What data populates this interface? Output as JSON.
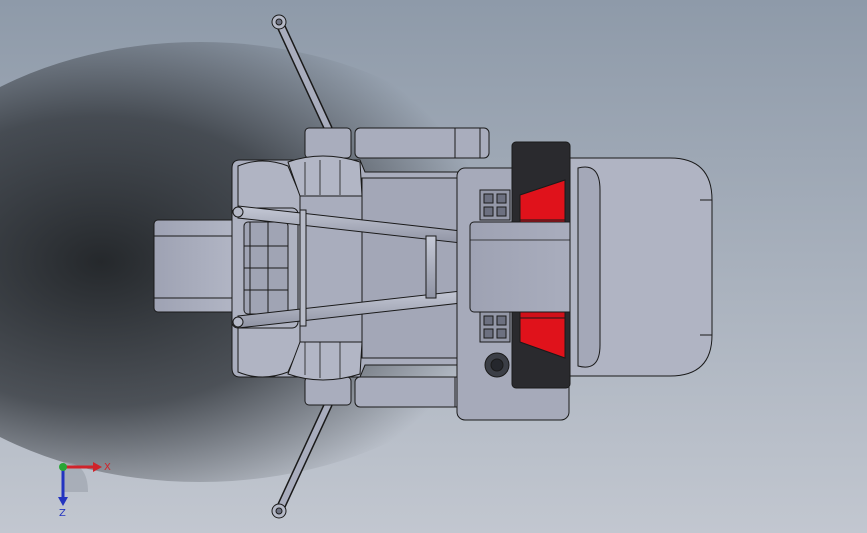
{
  "viewport": {
    "background_colors": {
      "top": "#8e9aa9",
      "bottom": "#c2c7d0",
      "shadow": "#1e2124"
    }
  },
  "model": {
    "body_color": "#a9adbd",
    "edge_color": "#1a1a1a",
    "accent_color": "#e0121b"
  },
  "triad": {
    "x_label": "X",
    "z_label": "Z",
    "x_color": "#d0232a",
    "y_color": "#29a636",
    "z_color": "#2334c0"
  }
}
